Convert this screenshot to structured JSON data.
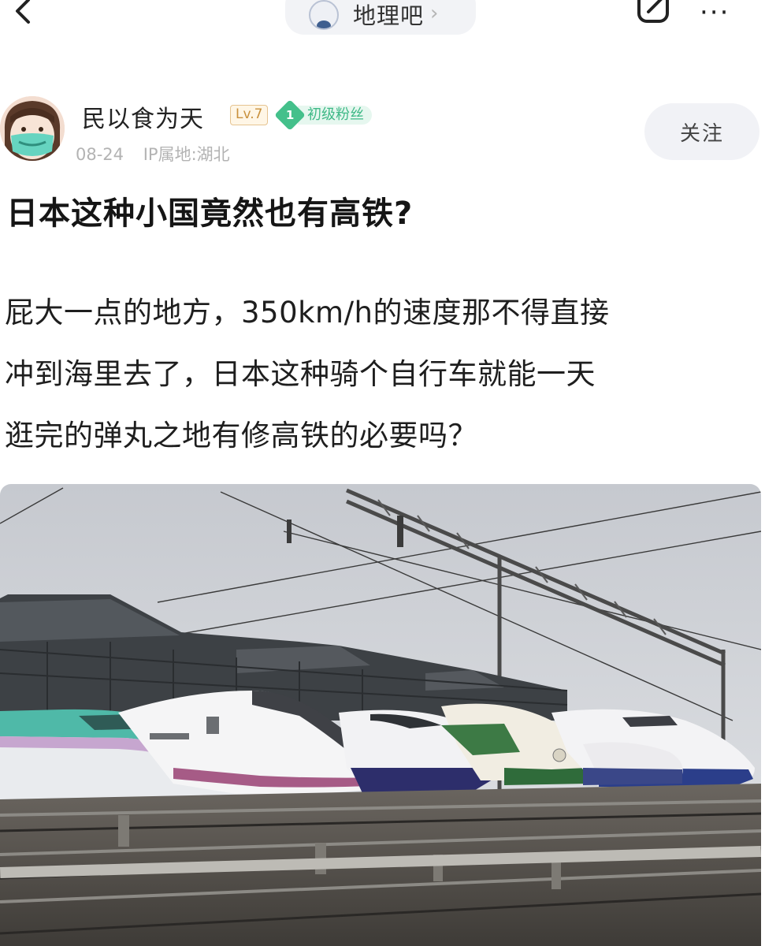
{
  "topbar": {
    "back_icon": "chevron-left-icon",
    "forum_name": "地理吧",
    "forum_chevron": "›",
    "edit_icon": "edit-icon",
    "more_label": "···"
  },
  "author": {
    "name": "民以食为天",
    "level": "Lv.7",
    "fan_level": "1",
    "fan_label": "初级粉丝",
    "date": "08-24",
    "ip_location": "IP属地:湖北",
    "follow_label": "关注"
  },
  "post": {
    "title": "日本这种小国竟然也有高铁?",
    "body_lines": [
      "屁大一点的地方，350km/h的速度那不得直接",
      "冲到海里去了，日本这种骑个自行车就能一天",
      "逛完的弹丸之地有修高铁的必要吗？"
    ],
    "image_icon": "bullet-trains-photo"
  },
  "colors": {
    "badge_gold": "#c9913e",
    "fan_green": "#44c08b",
    "meta_gray": "#b3b3b3",
    "pill_bg": "#f2f3f6"
  }
}
